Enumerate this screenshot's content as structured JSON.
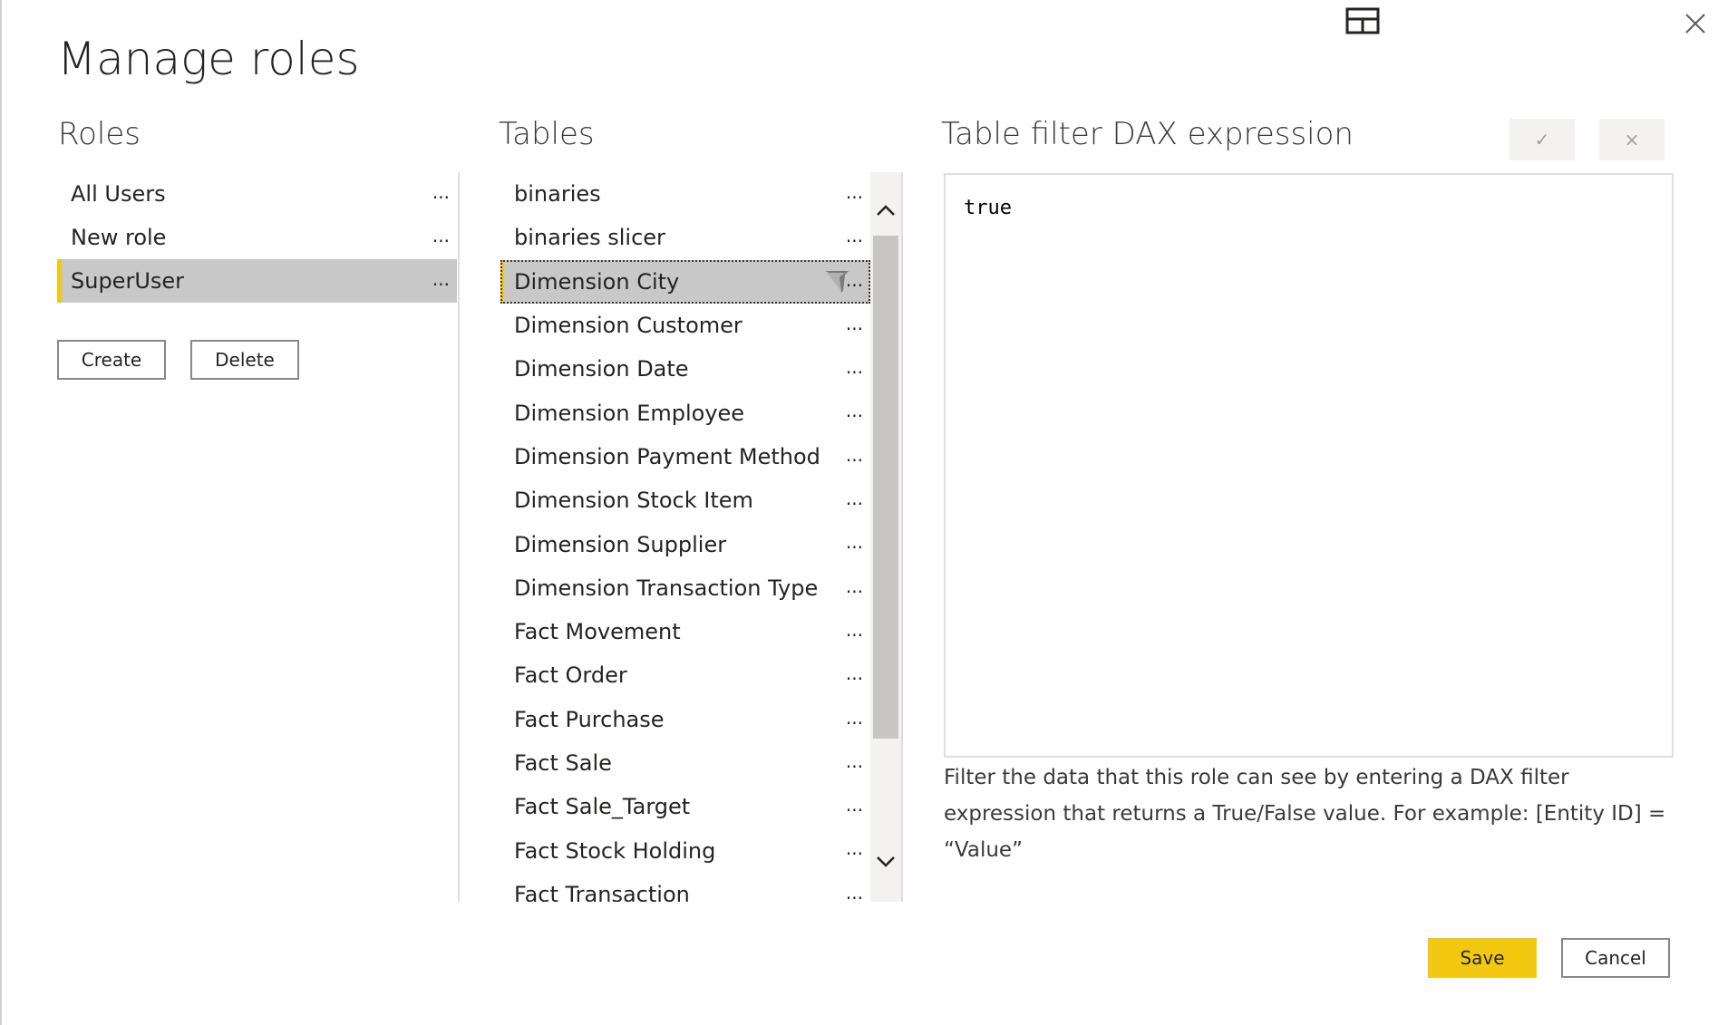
{
  "dialog": {
    "title": "Manage roles",
    "layout_icon": "layout-panels-icon",
    "close_icon": "close-icon"
  },
  "roles": {
    "header": "Roles",
    "items": [
      {
        "label": "All Users",
        "more": "...",
        "selected": false
      },
      {
        "label": "New role",
        "more": "...",
        "selected": false
      },
      {
        "label": "SuperUser",
        "more": "...",
        "selected": true
      }
    ],
    "create_label": "Create",
    "delete_label": "Delete"
  },
  "tables": {
    "header": "Tables",
    "items": [
      {
        "label": "binaries",
        "more": "..."
      },
      {
        "label": "binaries slicer",
        "more": "..."
      },
      {
        "label": "Dimension City",
        "more": "...",
        "selected": true,
        "has_filter": true
      },
      {
        "label": "Dimension Customer",
        "more": "..."
      },
      {
        "label": "Dimension Date",
        "more": "..."
      },
      {
        "label": "Dimension Employee",
        "more": "..."
      },
      {
        "label": "Dimension Payment Method",
        "more": "..."
      },
      {
        "label": "Dimension Stock Item",
        "more": "..."
      },
      {
        "label": "Dimension Supplier",
        "more": "..."
      },
      {
        "label": "Dimension Transaction Type",
        "more": "..."
      },
      {
        "label": "Fact Movement",
        "more": "..."
      },
      {
        "label": "Fact Order",
        "more": "..."
      },
      {
        "label": "Fact Purchase",
        "more": "..."
      },
      {
        "label": "Fact Sale",
        "more": "..."
      },
      {
        "label": "Fact Sale_Target",
        "more": "..."
      },
      {
        "label": "Fact Stock Holding",
        "more": "..."
      },
      {
        "label": "Fact Transaction",
        "more": "..."
      }
    ]
  },
  "dax": {
    "header": "Table filter DAX expression",
    "confirm_icon": "✓",
    "cancel_icon": "×",
    "expression": "true",
    "help_text": "Filter the data that this role can see by entering a DAX filter expression that returns a True/False value. For example: [Entity ID] = “Value”"
  },
  "footer": {
    "save_label": "Save",
    "cancel_label": "Cancel"
  },
  "colors": {
    "accent": "#f2c811",
    "selected_bg": "#c8c8c8",
    "text": "#252423"
  }
}
